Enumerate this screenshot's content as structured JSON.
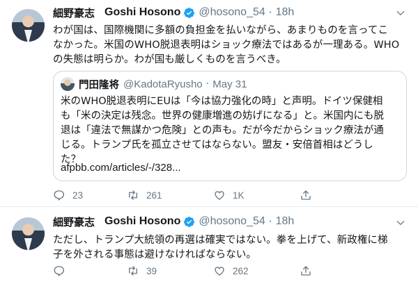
{
  "tweets": [
    {
      "author_name": "細野豪志",
      "author_name_en": "Goshi Hosono",
      "handle": "@hosono_54",
      "separator": "·",
      "time": "18h",
      "text_lines": [
        "わが国は、国際機関に多額の負担金を払いながら、あまりものを言ってこ",
        "なかった。米国のWHO脱退表明はショック療法ではあるが一理ある。WHO",
        "の失態は明らか。わが国も厳しくものを言うべき。"
      ],
      "quote": {
        "author_name": "門田隆将",
        "handle": "@KadotaRyusho",
        "separator": "·",
        "time": "May 31",
        "text_lines": [
          "米のWHO脱退表明にEUは「今は協力強化の時」と声明。ドイツ保健相",
          "も「米の決定は残念。世界の健康増進の妨げになる」と。米国内にも脱",
          "退は「違法で無謀かつ危険」との声も。だが今だからショック療法が通",
          "じる。トランプ氏を孤立させてはならない。盟友・安倍首相はどうし",
          "た？"
        ],
        "link": "afpbb.com/articles/-/328..."
      },
      "actions": {
        "replies": "23",
        "retweets": "261",
        "likes": "1K"
      }
    },
    {
      "author_name": "細野豪志",
      "author_name_en": "Goshi Hosono",
      "handle": "@hosono_54",
      "separator": "·",
      "time": "18h",
      "text_lines": [
        "ただし、トランプ大統領の再選は確実ではない。拳を上げて、新政権に梯",
        "子を外される事態は避けなければならない。"
      ],
      "actions": {
        "replies": "",
        "retweets": "39",
        "likes": "262"
      }
    }
  ],
  "colors": {
    "text": "#14171a",
    "secondary": "#657786",
    "verified": "#1da1f2",
    "divider": "#e6ecf0"
  },
  "icons": [
    "verified-badge-icon",
    "chevron-down-icon",
    "reply-icon",
    "retweet-icon",
    "like-icon",
    "share-icon"
  ]
}
